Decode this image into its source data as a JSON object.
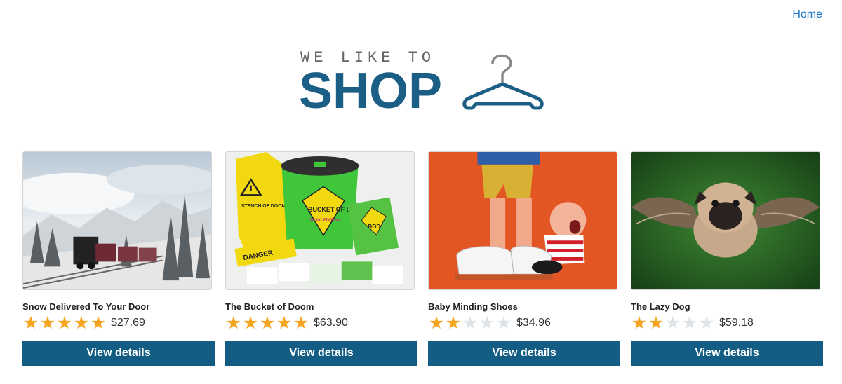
{
  "nav": {
    "home_label": "Home"
  },
  "logo": {
    "small_text": "WE LIKE TO",
    "big_text": "SHOP"
  },
  "products": [
    {
      "title": "Snow Delivered To Your Door",
      "rating": 5,
      "price": "$27.69",
      "button_label": "View details"
    },
    {
      "title": "The Bucket of Doom",
      "rating": 5,
      "price": "$63.90",
      "button_label": "View details"
    },
    {
      "title": "Baby Minding Shoes",
      "rating": 2,
      "price": "$34.96",
      "button_label": "View details"
    },
    {
      "title": "The Lazy Dog",
      "rating": 2,
      "price": "$59.18",
      "button_label": "View details"
    }
  ],
  "image_labels": {
    "bucket": "BUCKET OF DOOM",
    "bucket_sub": "TOXIC EDITION",
    "stench": "STENCH OF DOOM",
    "danger": "DANGER",
    "bod": "BOD"
  },
  "colors": {
    "accent": "#135d84",
    "star_on": "#f6a623",
    "star_off": "#dfe4e8",
    "link": "#1a74c7"
  }
}
